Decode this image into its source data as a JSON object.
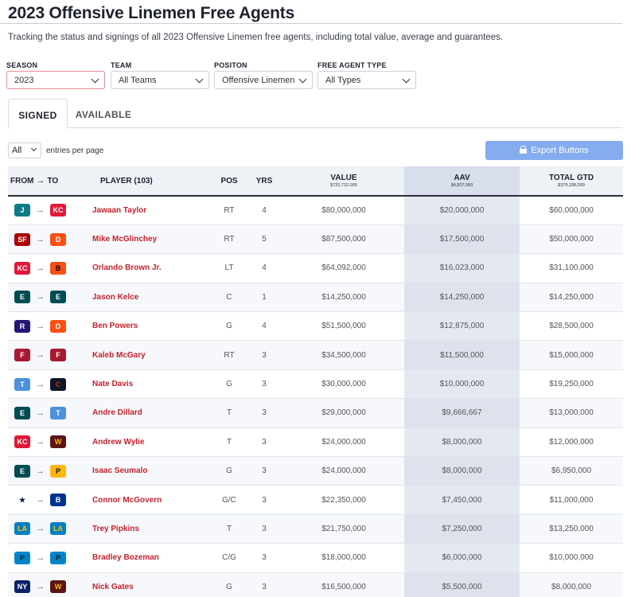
{
  "page": {
    "title": "2023 Offensive Linemen Free Agents",
    "subtitle": "Tracking the status and signings of all 2023 Offensive Linemen free agents, including total value, average and guarantees."
  },
  "filters": [
    {
      "label": "SEASON",
      "value": "2023"
    },
    {
      "label": "TEAM",
      "value": "All Teams"
    },
    {
      "label": "POSITON",
      "value": "Offensive Linemen"
    },
    {
      "label": "FREE AGENT TYPE",
      "value": "All Types"
    }
  ],
  "tabs": {
    "signed": "SIGNED",
    "available": "AVAILABLE"
  },
  "length": {
    "value": "All",
    "label": "entries per page"
  },
  "export": {
    "label": "Export Buttons",
    "color": "#86acf0"
  },
  "table": {
    "headers": {
      "from": "FROM",
      "to": "TO",
      "player": "PLAYER (103)",
      "pos": "POS",
      "yrs": "YRS",
      "value": "VALUE",
      "value_total": "$720,722,000",
      "aav": "AAV",
      "aav_total": "$4,837,060",
      "gtd": "TOTAL GTD",
      "gtd_total": "$379,338,000"
    },
    "rows": [
      {
        "from": "jaguars-logo",
        "to": "chiefs-logo",
        "player": "Jawaan Taylor",
        "pos": "RT",
        "yrs": "4",
        "value": "$80,000,000",
        "aav": "$20,000,000",
        "gtd": "$60,000,000"
      },
      {
        "from": "49ers-logo",
        "to": "broncos-logo",
        "player": "Mike McGlinchey",
        "pos": "RT",
        "yrs": "5",
        "value": "$87,500,000",
        "aav": "$17,500,000",
        "gtd": "$50,000,000"
      },
      {
        "from": "chiefs-logo",
        "to": "bengals-logo",
        "player": "Orlando Brown Jr.",
        "pos": "LT",
        "yrs": "4",
        "value": "$64,092,000",
        "aav": "$16,023,000",
        "gtd": "$31,100,000"
      },
      {
        "from": "eagles-logo",
        "to": "eagles-logo",
        "player": "Jason Kelce",
        "pos": "C",
        "yrs": "1",
        "value": "$14,250,000",
        "aav": "$14,250,000",
        "gtd": "$14,250,000"
      },
      {
        "from": "ravens-logo",
        "to": "broncos-logo",
        "player": "Ben Powers",
        "pos": "G",
        "yrs": "4",
        "value": "$51,500,000",
        "aav": "$12,875,000",
        "gtd": "$28,500,000"
      },
      {
        "from": "falcons-logo",
        "to": "falcons-logo",
        "player": "Kaleb McGary",
        "pos": "RT",
        "yrs": "3",
        "value": "$34,500,000",
        "aav": "$11,500,000",
        "gtd": "$15,000,000"
      },
      {
        "from": "titans-logo",
        "to": "bears-logo",
        "player": "Nate Davis",
        "pos": "G",
        "yrs": "3",
        "value": "$30,000,000",
        "aav": "$10,000,000",
        "gtd": "$19,250,000"
      },
      {
        "from": "eagles-logo",
        "to": "titans-logo",
        "player": "Andre Dillard",
        "pos": "T",
        "yrs": "3",
        "value": "$29,000,000",
        "aav": "$9,666,667",
        "gtd": "$13,000,000"
      },
      {
        "from": "chiefs-logo",
        "to": "commanders-logo",
        "player": "Andrew Wylie",
        "pos": "T",
        "yrs": "3",
        "value": "$24,000,000",
        "aav": "$8,000,000",
        "gtd": "$12,000,000"
      },
      {
        "from": "eagles-logo",
        "to": "steelers-logo",
        "player": "Isaac Seumalo",
        "pos": "G",
        "yrs": "3",
        "value": "$24,000,000",
        "aav": "$8,000,000",
        "gtd": "$6,950,000"
      },
      {
        "from": "cowboys-logo",
        "to": "bills-logo",
        "player": "Connor McGovern",
        "pos": "G/C",
        "yrs": "3",
        "value": "$22,350,000",
        "aav": "$7,450,000",
        "gtd": "$11,000,000"
      },
      {
        "from": "chargers-logo",
        "to": "chargers-logo",
        "player": "Trey Pipkins",
        "pos": "T",
        "yrs": "3",
        "value": "$21,750,000",
        "aav": "$7,250,000",
        "gtd": "$13,250,000"
      },
      {
        "from": "panthers-logo",
        "to": "panthers-logo",
        "player": "Bradley Bozeman",
        "pos": "C/G",
        "yrs": "3",
        "value": "$18,000,000",
        "aav": "$6,000,000",
        "gtd": "$10,000,000"
      },
      {
        "from": "giants-logo",
        "to": "commanders-logo",
        "player": "Nick Gates",
        "pos": "G",
        "yrs": "3",
        "value": "$16,500,000",
        "aav": "$5,500,000",
        "gtd": "$8,000,000"
      }
    ]
  }
}
